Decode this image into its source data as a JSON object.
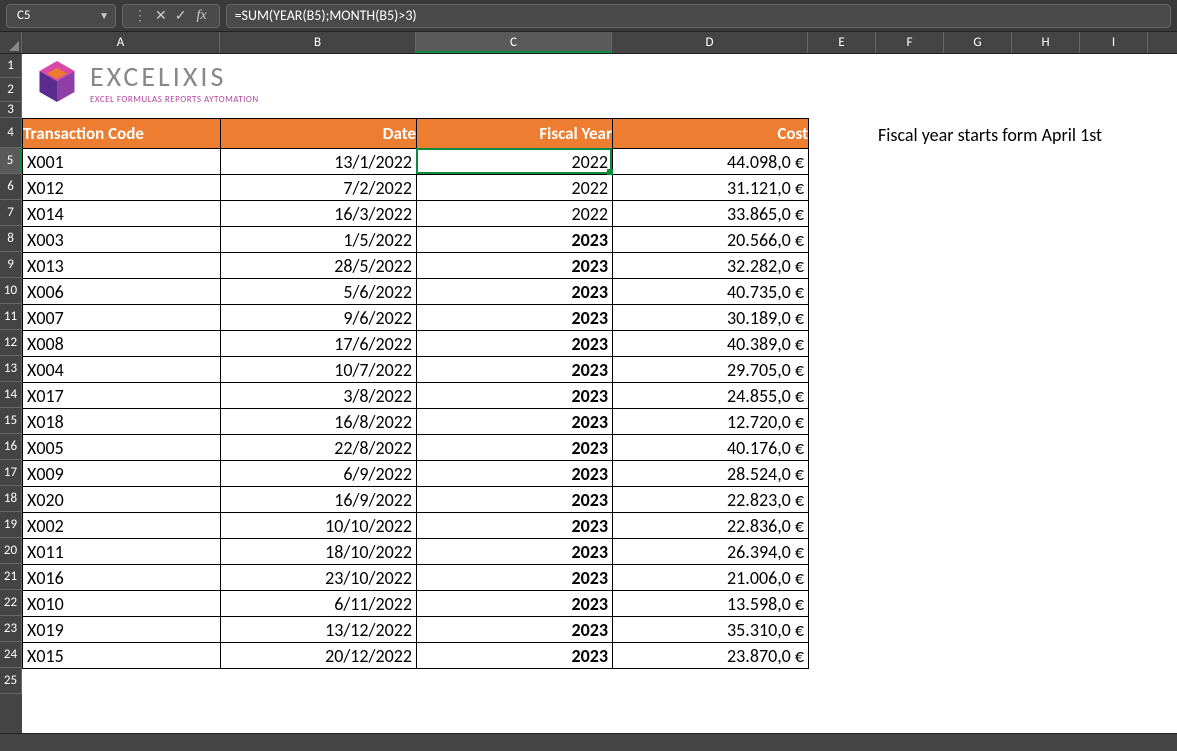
{
  "nameBox": {
    "value": "C5"
  },
  "formulaBar": {
    "value": "=SUM(YEAR(B5);MONTH(B5)>3)",
    "fxLabel": "fx",
    "cancel": "✕",
    "enter": "✓"
  },
  "columns": [
    "A",
    "B",
    "C",
    "D",
    "E",
    "F",
    "G",
    "H",
    "I"
  ],
  "rows": [
    1,
    2,
    3,
    4,
    5,
    6,
    7,
    8,
    9,
    10,
    11,
    12,
    13,
    14,
    15,
    16,
    17,
    18,
    19,
    20,
    21,
    22,
    23,
    24,
    25
  ],
  "activeCell": {
    "col": "C",
    "row": 5
  },
  "logo": {
    "title": "EXCELIXIS",
    "subtitle": "EXCEL FORMULAS REPORTS AYTOMATION"
  },
  "tableHeaders": {
    "a": "Transaction Code",
    "b": "Date",
    "c": "Fiscal Year",
    "d": "Cost"
  },
  "sideNote": "Fiscal year starts form April 1st",
  "data": [
    {
      "code": "X001",
      "date": "13/1/2022",
      "fy": "2022",
      "bold": false,
      "cost": "44.098,0 €"
    },
    {
      "code": "X012",
      "date": "7/2/2022",
      "fy": "2022",
      "bold": false,
      "cost": "31.121,0 €"
    },
    {
      "code": "X014",
      "date": "16/3/2022",
      "fy": "2022",
      "bold": false,
      "cost": "33.865,0 €"
    },
    {
      "code": "X003",
      "date": "1/5/2022",
      "fy": "2023",
      "bold": true,
      "cost": "20.566,0 €"
    },
    {
      "code": "X013",
      "date": "28/5/2022",
      "fy": "2023",
      "bold": true,
      "cost": "32.282,0 €"
    },
    {
      "code": "X006",
      "date": "5/6/2022",
      "fy": "2023",
      "bold": true,
      "cost": "40.735,0 €"
    },
    {
      "code": "X007",
      "date": "9/6/2022",
      "fy": "2023",
      "bold": true,
      "cost": "30.189,0 €"
    },
    {
      "code": "X008",
      "date": "17/6/2022",
      "fy": "2023",
      "bold": true,
      "cost": "40.389,0 €"
    },
    {
      "code": "X004",
      "date": "10/7/2022",
      "fy": "2023",
      "bold": true,
      "cost": "29.705,0 €"
    },
    {
      "code": "X017",
      "date": "3/8/2022",
      "fy": "2023",
      "bold": true,
      "cost": "24.855,0 €"
    },
    {
      "code": "X018",
      "date": "16/8/2022",
      "fy": "2023",
      "bold": true,
      "cost": "12.720,0 €"
    },
    {
      "code": "X005",
      "date": "22/8/2022",
      "fy": "2023",
      "bold": true,
      "cost": "40.176,0 €"
    },
    {
      "code": "X009",
      "date": "6/9/2022",
      "fy": "2023",
      "bold": true,
      "cost": "28.524,0 €"
    },
    {
      "code": "X020",
      "date": "16/9/2022",
      "fy": "2023",
      "bold": true,
      "cost": "22.823,0 €"
    },
    {
      "code": "X002",
      "date": "10/10/2022",
      "fy": "2023",
      "bold": true,
      "cost": "22.836,0 €"
    },
    {
      "code": "X011",
      "date": "18/10/2022",
      "fy": "2023",
      "bold": true,
      "cost": "26.394,0 €"
    },
    {
      "code": "X016",
      "date": "23/10/2022",
      "fy": "2023",
      "bold": true,
      "cost": "21.006,0 €"
    },
    {
      "code": "X010",
      "date": "6/11/2022",
      "fy": "2023",
      "bold": true,
      "cost": "13.598,0 €"
    },
    {
      "code": "X019",
      "date": "13/12/2022",
      "fy": "2023",
      "bold": true,
      "cost": "35.310,0 €"
    },
    {
      "code": "X015",
      "date": "20/12/2022",
      "fy": "2023",
      "bold": true,
      "cost": "23.870,0 €"
    }
  ]
}
